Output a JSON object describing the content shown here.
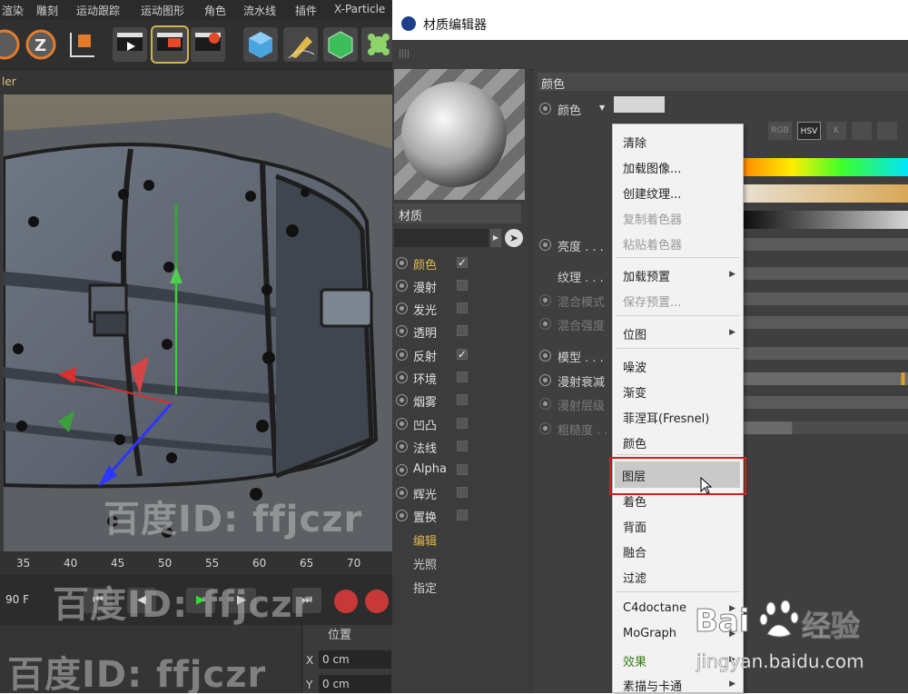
{
  "menubar": {
    "items": [
      "渲染",
      "雕刻",
      "运动跟踪",
      "运动图形",
      "角色",
      "流水线",
      "插件",
      "X-Particle"
    ]
  },
  "viewport": {
    "header_label": "ler"
  },
  "timeline": {
    "ticks": [
      "35",
      "40",
      "45",
      "50",
      "55",
      "60",
      "65",
      "70"
    ],
    "frame_field": "90 F"
  },
  "coords": {
    "section_label": "位置",
    "x_label": "X",
    "x_value": "0 cm",
    "y_label": "Y",
    "y_value": "0 cm"
  },
  "watermarks": {
    "text": "百度ID: ffjczr"
  },
  "editor": {
    "title": "材质编辑器",
    "material_label": "材质",
    "channels": [
      {
        "label": "颜色",
        "checked": true,
        "active": true
      },
      {
        "label": "漫射",
        "checked": false
      },
      {
        "label": "发光",
        "checked": false
      },
      {
        "label": "透明",
        "checked": false
      },
      {
        "label": "反射",
        "checked": true
      },
      {
        "label": "环境",
        "checked": false
      },
      {
        "label": "烟雾",
        "checked": false
      },
      {
        "label": "凹凸",
        "checked": false
      },
      {
        "label": "法线",
        "checked": false
      },
      {
        "label": "Alpha",
        "checked": false
      },
      {
        "label": "辉光",
        "checked": false
      },
      {
        "label": "置换",
        "checked": false
      }
    ],
    "tabs": [
      {
        "label": "编辑",
        "active": true
      },
      {
        "label": "光照"
      },
      {
        "label": "指定"
      }
    ],
    "panel_header": "颜色",
    "props": {
      "color": "颜色",
      "brightness": "亮度 . . .",
      "texture": "纹理 . . .",
      "blend_mode": "混合模式",
      "blend_strength": "混合强度",
      "model": "模型 . . .",
      "diffuse_falloff": "漫射衰减",
      "diffuse_level": "漫射层级",
      "roughness": "粗糙度 . . ."
    },
    "color_modes": [
      "RGB",
      "HSV",
      "K"
    ],
    "swatch_color": "#d6d6d6"
  },
  "context_menu": {
    "items": [
      {
        "label": "清除"
      },
      {
        "label": "加载图像..."
      },
      {
        "label": "创建纹理..."
      },
      {
        "label": "复制着色器",
        "disabled": true
      },
      {
        "label": "粘贴着色器",
        "disabled": true
      },
      {
        "label": "加载预置",
        "submenu": true
      },
      {
        "label": "保存预置...",
        "disabled": true
      },
      {
        "label": "位图",
        "submenu": true
      },
      {
        "label": "噪波"
      },
      {
        "label": "渐变"
      },
      {
        "label": "菲涅耳(Fresnel)"
      },
      {
        "label": "颜色"
      },
      {
        "label": "图层",
        "highlighted": true
      },
      {
        "label": "着色"
      },
      {
        "label": "背面"
      },
      {
        "label": "融合"
      },
      {
        "label": "过滤"
      },
      {
        "label": "C4doctane",
        "submenu": true
      },
      {
        "label": "MoGraph",
        "submenu": true
      },
      {
        "label": "效果",
        "submenu": true
      },
      {
        "label": "素描与卡通",
        "submenu": true
      }
    ]
  },
  "baidu": {
    "logo_text_1": "Bai",
    "logo_text_2": "经验",
    "url": "jingyan.baidu.com"
  },
  "colors": {
    "highlight_border": "#d51d1d",
    "accent_text": "#e0b94a",
    "baidu_blue": "#2319dc"
  }
}
